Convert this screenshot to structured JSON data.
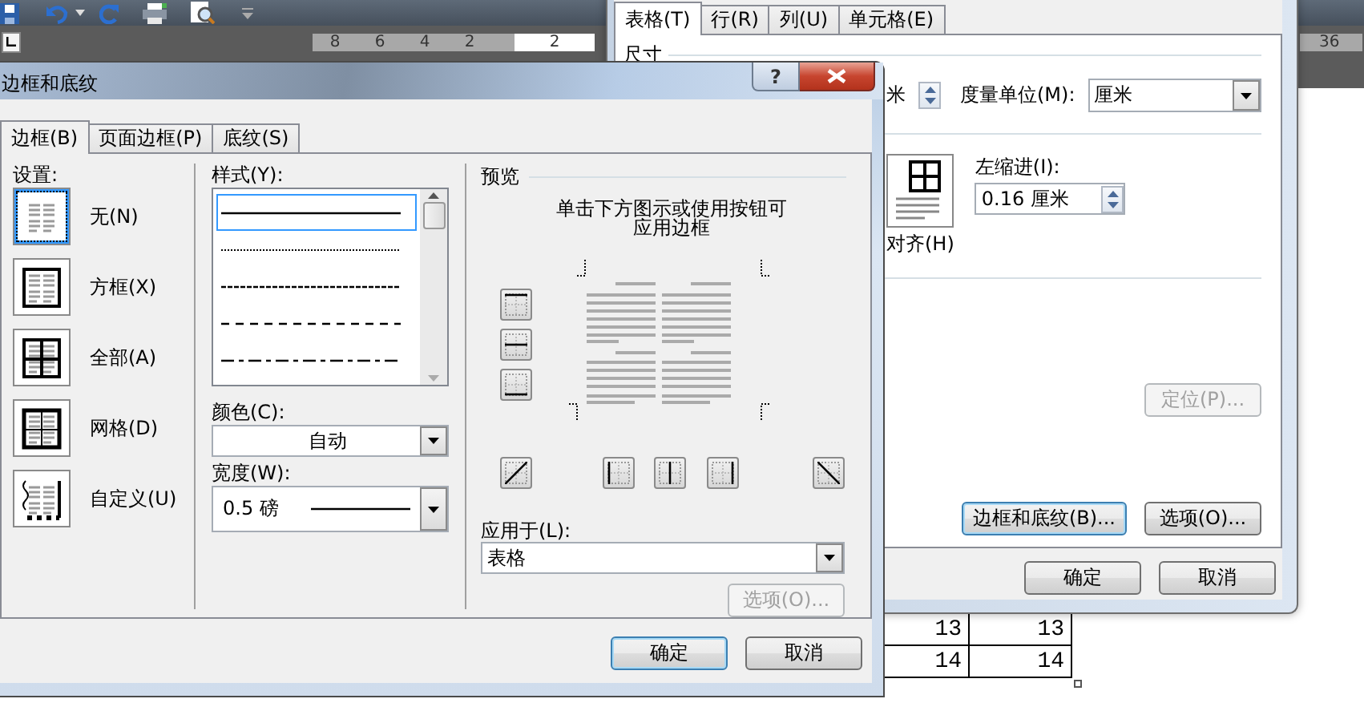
{
  "word_window": {
    "ruler_numbers": [
      "8",
      "6",
      "4",
      "2"
    ],
    "ruler_current": "2",
    "ruler_far_number": "36",
    "document_table": {
      "rows": [
        [
          "13",
          "13"
        ],
        [
          "14",
          "14"
        ]
      ]
    }
  },
  "table_properties_dialog": {
    "tabs": [
      {
        "label": "表格(T)",
        "selected": true
      },
      {
        "label": "行(R)",
        "selected": false
      },
      {
        "label": "列(U)",
        "selected": false
      },
      {
        "label": "单元格(E)",
        "selected": false
      }
    ],
    "size_heading": "尺寸",
    "width_unit_tail": "米",
    "measure_label": "度量单位(M):",
    "measure_value": "厘米",
    "alignment_label": "对齐(H)",
    "indent_label": "左缩进(I):",
    "indent_value": "0.16 厘米",
    "buttons": [
      {
        "label": "定位(P)...",
        "disabled": true,
        "focused": false
      },
      {
        "label": "边框和底纹(B)...",
        "disabled": false,
        "focused": true
      },
      {
        "label": "选项(O)...",
        "disabled": false,
        "focused": false
      }
    ],
    "footer_buttons": [
      {
        "label": "确定",
        "disabled": false,
        "focused": false
      },
      {
        "label": "取消",
        "disabled": false,
        "focused": false
      }
    ]
  },
  "borders_dialog": {
    "title": "边框和底纹",
    "help_button": "?",
    "tabs": [
      {
        "label": "边框(B)",
        "selected": true
      },
      {
        "label": "页面边框(P)",
        "selected": false
      },
      {
        "label": "底纹(S)",
        "selected": false
      }
    ],
    "settings_label": "设置:",
    "settings": [
      {
        "kind": "none",
        "label": "无(N)",
        "selected": true
      },
      {
        "kind": "box",
        "label": "方框(X)",
        "selected": false
      },
      {
        "kind": "all",
        "label": "全部(A)",
        "selected": false
      },
      {
        "kind": "grid",
        "label": "网格(D)",
        "selected": false
      },
      {
        "kind": "custom",
        "label": "自定义(U)",
        "selected": false
      }
    ],
    "style_label": "样式(Y):",
    "line_styles": [
      {
        "kind": "solid",
        "selected": true
      },
      {
        "kind": "dotted",
        "selected": false
      },
      {
        "kind": "dashed",
        "selected": false
      },
      {
        "kind": "long-dash",
        "selected": false
      },
      {
        "kind": "dash-dot",
        "selected": false
      }
    ],
    "color_label": "颜色(C):",
    "color_value": "自动",
    "width_label": "宽度(W):",
    "width_value": "0.5 磅",
    "preview_label": "预览",
    "preview_hint_lines": [
      "单击下方图示或使用按钮可",
      "应用边框"
    ],
    "apply_label": "应用于(L):",
    "apply_value": "表格",
    "options_button": {
      "label": "选项(O)...",
      "disabled": true,
      "focused": false
    },
    "footer_buttons": [
      {
        "label": "确定",
        "disabled": false,
        "focused": true
      },
      {
        "label": "取消",
        "disabled": false,
        "focused": false
      }
    ]
  }
}
